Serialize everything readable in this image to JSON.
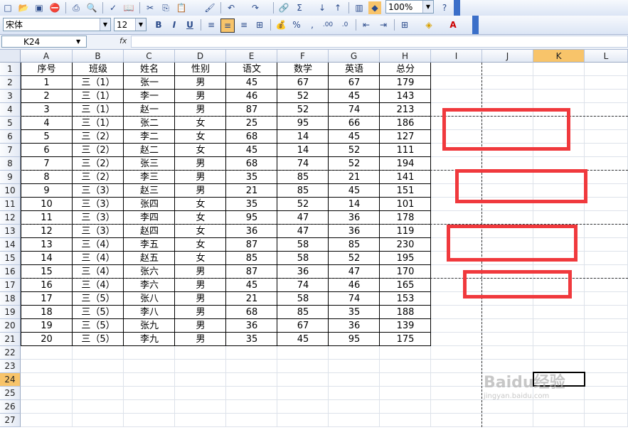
{
  "toolbar": {
    "zoom": "100%",
    "font_name": "宋体",
    "font_size": "12",
    "bold": "B",
    "italic": "I",
    "underline": "U",
    "percent": "%",
    "comma": ",",
    "autosum": "Σ",
    "fx": "fx"
  },
  "name_box": "K24",
  "columns": [
    "A",
    "B",
    "C",
    "D",
    "E",
    "F",
    "G",
    "H",
    "I",
    "J",
    "K",
    "L"
  ],
  "rows": [
    "1",
    "2",
    "3",
    "4",
    "5",
    "6",
    "7",
    "8",
    "9",
    "10",
    "11",
    "12",
    "13",
    "14",
    "15",
    "16",
    "17",
    "18",
    "19",
    "20",
    "21",
    "22",
    "23",
    "24",
    "25",
    "26",
    "27"
  ],
  "selected": {
    "column": "K",
    "row": "24"
  },
  "table": {
    "headers": [
      "序号",
      "班级",
      "姓名",
      "性别",
      "语文",
      "数学",
      "英语",
      "总分"
    ],
    "rows": [
      [
        "1",
        "三（1）",
        "张一",
        "男",
        "45",
        "67",
        "67",
        "179"
      ],
      [
        "2",
        "三（1）",
        "李一",
        "男",
        "46",
        "52",
        "45",
        "143"
      ],
      [
        "3",
        "三（1）",
        "赵一",
        "男",
        "87",
        "52",
        "74",
        "213"
      ],
      [
        "4",
        "三（1）",
        "张二",
        "女",
        "25",
        "95",
        "66",
        "186"
      ],
      [
        "5",
        "三（2）",
        "李二",
        "女",
        "68",
        "14",
        "45",
        "127"
      ],
      [
        "6",
        "三（2）",
        "赵二",
        "女",
        "45",
        "14",
        "52",
        "111"
      ],
      [
        "7",
        "三（2）",
        "张三",
        "男",
        "68",
        "74",
        "52",
        "194"
      ],
      [
        "8",
        "三（2）",
        "李三",
        "男",
        "35",
        "85",
        "21",
        "141"
      ],
      [
        "9",
        "三（3）",
        "赵三",
        "男",
        "21",
        "85",
        "45",
        "151"
      ],
      [
        "10",
        "三（3）",
        "张四",
        "女",
        "35",
        "52",
        "14",
        "101"
      ],
      [
        "11",
        "三（3）",
        "李四",
        "女",
        "95",
        "47",
        "36",
        "178"
      ],
      [
        "12",
        "三（3）",
        "赵四",
        "女",
        "36",
        "47",
        "36",
        "119"
      ],
      [
        "13",
        "三（4）",
        "李五",
        "女",
        "87",
        "58",
        "85",
        "230"
      ],
      [
        "14",
        "三（4）",
        "赵五",
        "女",
        "85",
        "58",
        "52",
        "195"
      ],
      [
        "15",
        "三（4）",
        "张六",
        "男",
        "87",
        "36",
        "47",
        "170"
      ],
      [
        "16",
        "三（4）",
        "李六",
        "男",
        "45",
        "74",
        "46",
        "165"
      ],
      [
        "17",
        "三（5）",
        "张八",
        "男",
        "21",
        "58",
        "74",
        "153"
      ],
      [
        "18",
        "三（5）",
        "李八",
        "男",
        "68",
        "85",
        "35",
        "188"
      ],
      [
        "19",
        "三（5）",
        "张九",
        "男",
        "36",
        "67",
        "36",
        "139"
      ],
      [
        "20",
        "三（5）",
        "李九",
        "男",
        "35",
        "45",
        "95",
        "175"
      ]
    ]
  },
  "watermark": {
    "brand": "Baidu经验",
    "url": "jingyan.baidu.com"
  },
  "colors": {
    "highlight_box": "#f0393d",
    "selected_header": "#f8c46a"
  }
}
